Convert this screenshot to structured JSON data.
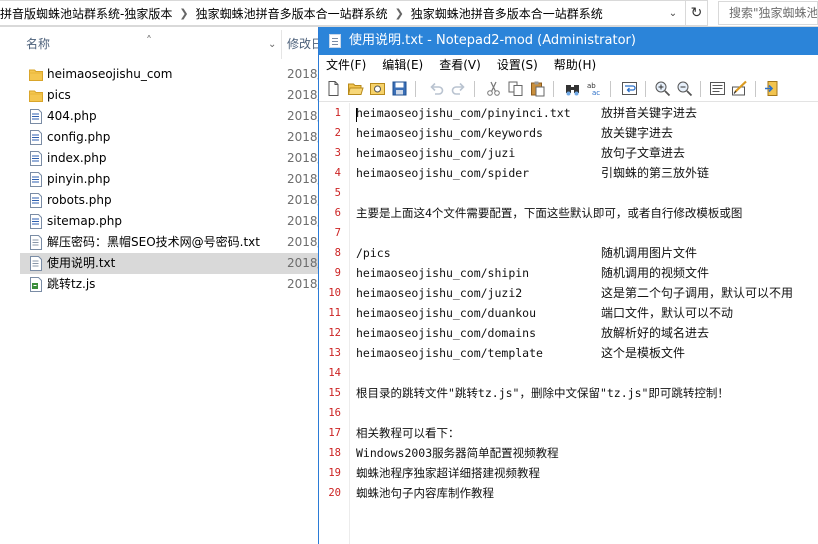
{
  "explorer": {
    "breadcrumb": [
      "拼音版蜘蛛池站群系统-独家版本",
      "独家蜘蛛池拼音多版本合一站群系统",
      "独家蜘蛛池拼音多版本合一站群系统"
    ],
    "search_placeholder": "搜索\"独家蜘蛛池拼",
    "columns": {
      "name": "名称",
      "date": "修改日"
    },
    "files": [
      {
        "name": "heimaoseojishu_com",
        "date": "2018/",
        "type": "folder"
      },
      {
        "name": "pics",
        "date": "2018/",
        "type": "folder"
      },
      {
        "name": "404.php",
        "date": "2018/",
        "type": "php"
      },
      {
        "name": "config.php",
        "date": "2018/",
        "type": "php"
      },
      {
        "name": "index.php",
        "date": "2018/",
        "type": "php"
      },
      {
        "name": "pinyin.php",
        "date": "2018/",
        "type": "php"
      },
      {
        "name": "robots.php",
        "date": "2018/",
        "type": "php"
      },
      {
        "name": "sitemap.php",
        "date": "2018/",
        "type": "php"
      },
      {
        "name": "解压密码：黑帽SEO技术网@号密码.txt",
        "date": "2018/",
        "type": "txt"
      },
      {
        "name": "使用说明.txt",
        "date": "2018/",
        "type": "txt",
        "selected": true
      },
      {
        "name": "跳转tz.js",
        "date": "2018/",
        "type": "js"
      }
    ]
  },
  "notepad": {
    "title": "使用说明.txt - Notepad2-mod (Administrator)",
    "menu": [
      "文件(F)",
      "编辑(E)",
      "查看(V)",
      "设置(S)",
      "帮助(H)"
    ],
    "lines": [
      {
        "n": "1",
        "a": "heimaoseojishu_com/pinyinci.txt",
        "b": "放拼音关键字进去"
      },
      {
        "n": "2",
        "a": "heimaoseojishu_com/keywords",
        "b": "放关键字进去"
      },
      {
        "n": "3",
        "a": "heimaoseojishu_com/juzi",
        "b": "放句子文章进去"
      },
      {
        "n": "4",
        "a": "heimaoseojishu_com/spider",
        "b": "引蜘蛛的第三放外链"
      },
      {
        "n": "5",
        "a": "",
        "b": ""
      },
      {
        "n": "6",
        "a": "主要是上面这4个文件需要配置，下面这些默认即可，或者自行修改模板或图",
        "b": ""
      },
      {
        "n": "7",
        "a": "",
        "b": ""
      },
      {
        "n": "8",
        "a": "/pics",
        "b": "随机调用图片文件"
      },
      {
        "n": "9",
        "a": "heimaoseojishu_com/shipin",
        "b": "随机调用的视频文件"
      },
      {
        "n": "10",
        "a": "heimaoseojishu_com/juzi2",
        "b": "这是第二个句子调用，默认可以不用"
      },
      {
        "n": "11",
        "a": "heimaoseojishu_com/duankou",
        "b": "端口文件，默认可以不动"
      },
      {
        "n": "12",
        "a": "heimaoseojishu_com/domains",
        "b": "放解析好的域名进去"
      },
      {
        "n": "13",
        "a": "heimaoseojishu_com/template",
        "b": "这个是模板文件"
      },
      {
        "n": "14",
        "a": "",
        "b": ""
      },
      {
        "n": "15",
        "a": "根目录的跳转文件\"跳转tz.js\"，删除中文保留\"tz.js\"即可跳转控制！",
        "b": ""
      },
      {
        "n": "16",
        "a": "",
        "b": ""
      },
      {
        "n": "17",
        "a": "相关教程可以看下：",
        "b": ""
      },
      {
        "n": "18",
        "a": "Windows2003服务器简单配置视频教程",
        "b": ""
      },
      {
        "n": "19",
        "a": "蜘蛛池程序独家超详细搭建视频教程",
        "b": ""
      },
      {
        "n": "20",
        "a": "蜘蛛池句子内容库制作教程",
        "b": ""
      }
    ]
  }
}
